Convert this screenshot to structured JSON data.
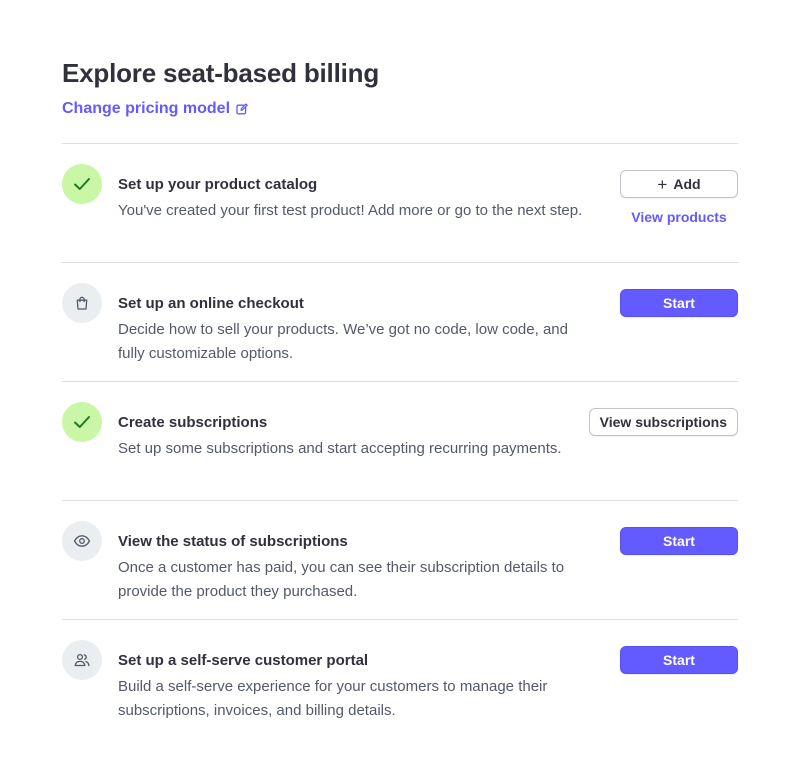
{
  "header": {
    "title": "Explore seat-based billing",
    "change_pricing_label": "Change pricing model"
  },
  "colors": {
    "accent": "#635bff",
    "done_bg": "#c9f7a5",
    "done_check": "#1f7a1f",
    "todo_bg": "#ebeef1"
  },
  "steps": [
    {
      "title": "Set up your product catalog",
      "description": "You've created your first test product! Add more or go to the next step.",
      "status": "done",
      "icon": "check-icon",
      "primary_label": "Add",
      "secondary_link": "View products"
    },
    {
      "title": "Set up an online checkout",
      "description": "Decide how to sell your products. We’ve got no code, low code, and fully customizable options.",
      "status": "todo",
      "icon": "shopping-bag-icon",
      "primary_label": "Start"
    },
    {
      "title": "Create subscriptions",
      "description": "Set up some subscriptions and start accepting recurring payments.",
      "status": "done",
      "icon": "check-icon",
      "primary_label": "View subscriptions"
    },
    {
      "title": "View the status of subscriptions",
      "description": "Once a customer has paid, you can see their subscription details to provide the product they purchased.",
      "status": "todo",
      "icon": "eye-icon",
      "primary_label": "Start"
    },
    {
      "title": "Set up a self-serve customer portal",
      "description": "Build a self-serve experience for your customers to manage their subscriptions, invoices, and billing details.",
      "status": "todo",
      "icon": "users-icon",
      "primary_label": "Start"
    }
  ]
}
